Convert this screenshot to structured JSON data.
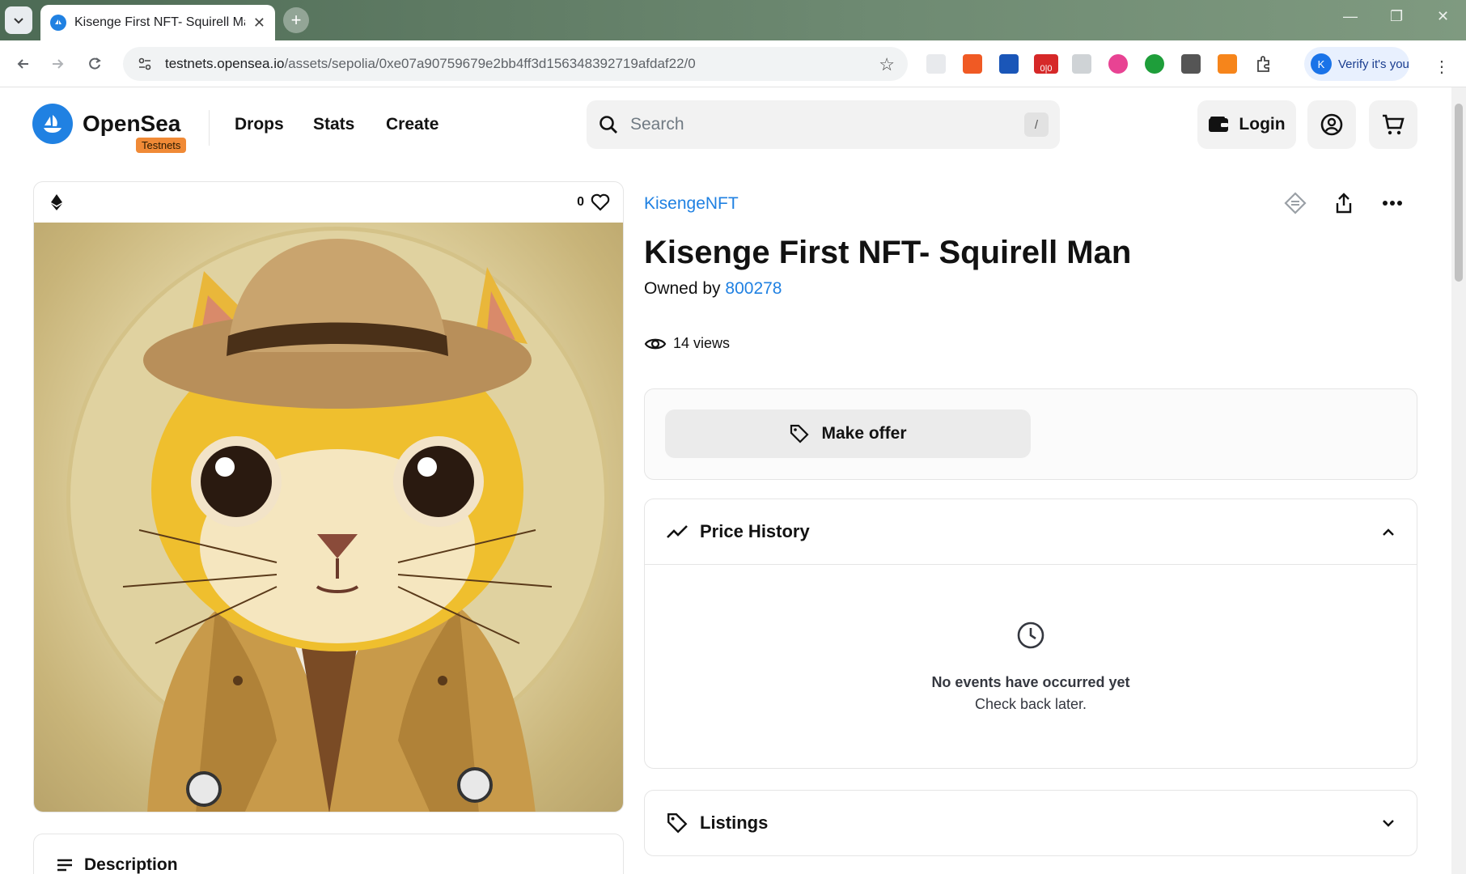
{
  "browser": {
    "tab_title": "Kisenge First NFT- Squirell Man",
    "url_host": "testnets.opensea.io",
    "url_path": "/assets/sepolia/0xe07a90759679e2bb4ff3d156348392719afdaf22/0",
    "verify_label": "Verify it's you",
    "verify_avatar": "K",
    "extension_badge": "0|0"
  },
  "header": {
    "brand": "OpenSea",
    "badge": "Testnets",
    "nav": [
      "Drops",
      "Stats",
      "Create"
    ],
    "search_placeholder": "Search",
    "search_shortcut": "/",
    "login_label": "Login"
  },
  "asset": {
    "likes": "0",
    "collection": "KisengeNFT",
    "title": "Kisenge First NFT- Squirell Man",
    "owned_prefix": "Owned by",
    "owner": "800278",
    "views": "14 views",
    "make_offer": "Make offer"
  },
  "panels": {
    "price_history": "Price History",
    "empty_title": "No events have occurred yet",
    "empty_sub": "Check back later.",
    "listings": "Listings",
    "description": "Description"
  },
  "colors": {
    "accent": "#2081e2",
    "badge": "#f08a36"
  }
}
